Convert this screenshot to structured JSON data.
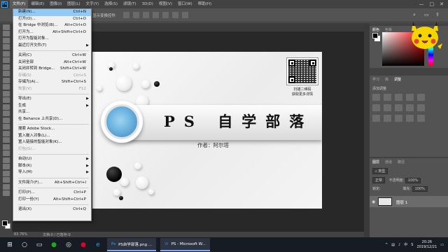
{
  "menubar": {
    "logo": "Ps",
    "items": [
      "文件(F)",
      "编辑(E)",
      "图像(I)",
      "图层(L)",
      "文字(Y)",
      "选择(S)",
      "滤镜(T)",
      "3D(D)",
      "视图(V)",
      "窗口(W)",
      "帮助(H)"
    ],
    "active_index": 0,
    "window_controls": [
      "—",
      "□",
      "✕"
    ]
  },
  "optionsbar": {
    "text": "显示变换控件"
  },
  "file_menu": {
    "groups": [
      [
        {
          "label": "新建(N)...",
          "shortcut": "Ctrl+N",
          "highlighted": true
        },
        {
          "label": "打开(O)...",
          "shortcut": "Ctrl+O"
        },
        {
          "label": "在 Bridge 中浏览(B)...",
          "shortcut": "Alt+Ctrl+O"
        },
        {
          "label": "打开为...",
          "shortcut": "Alt+Shift+Ctrl+O"
        },
        {
          "label": "打开为智能对象..."
        },
        {
          "label": "最近打开文件(T)",
          "submenu": true
        }
      ],
      [
        {
          "label": "关闭(C)",
          "shortcut": "Ctrl+W"
        },
        {
          "label": "关闭全部",
          "shortcut": "Alt+Ctrl+W"
        },
        {
          "label": "关闭并转到 Bridge...",
          "shortcut": "Shift+Ctrl+W"
        },
        {
          "label": "存储(S)",
          "shortcut": "Ctrl+S",
          "disabled": true
        },
        {
          "label": "存储为(A)...",
          "shortcut": "Shift+Ctrl+S"
        },
        {
          "label": "恢复(V)",
          "shortcut": "F12",
          "disabled": true
        }
      ],
      [
        {
          "label": "导出(E)",
          "submenu": true
        },
        {
          "label": "生成",
          "submenu": true
        },
        {
          "label": "共享..."
        },
        {
          "label": "在 Behance 上共享(D)..."
        }
      ],
      [
        {
          "label": "搜索 Adobe Stock..."
        },
        {
          "label": "置入嵌入对象(L)..."
        },
        {
          "label": "置入链接的智能对象(K)..."
        },
        {
          "label": "打包(G)...",
          "disabled": true
        }
      ],
      [
        {
          "label": "自动(U)",
          "submenu": true
        },
        {
          "label": "脚本(R)",
          "submenu": true
        },
        {
          "label": "导入(M)",
          "submenu": true
        }
      ],
      [
        {
          "label": "文件简介(F)...",
          "shortcut": "Alt+Shift+Ctrl+I"
        }
      ],
      [
        {
          "label": "打印(P)...",
          "shortcut": "Ctrl+P"
        },
        {
          "label": "打印一份(Y)",
          "shortcut": "Alt+Shift+Ctrl+P"
        }
      ],
      [
        {
          "label": "退出(X)",
          "shortcut": "Ctrl+Q"
        }
      ]
    ]
  },
  "document": {
    "title": "PS 自学部落",
    "author": "作者：阿尔塔",
    "qr_caption_1": "扫描二维码",
    "qr_caption_2": "获取更多详情"
  },
  "statusbar": {
    "zoom": "63.76%",
    "info": "文档:0 / 已暂存:0"
  },
  "panels": {
    "color_tabs": [
      "颜色",
      "色板"
    ],
    "adjust_tabs": [
      "学习",
      "库",
      "调整"
    ],
    "adjust_label": "添加调整",
    "layers_tabs": [
      "图层",
      "通道",
      "路径"
    ],
    "kind_label": "类型",
    "blend_mode": "正常",
    "opacity_label": "不透明度:",
    "opacity_value": "100%",
    "lock_label": "锁定:",
    "fill_label": "填充:",
    "fill_value": "100%",
    "layer_name": "图层 1"
  },
  "taskbar": {
    "tasks": [
      {
        "label": "PS自学部落.png ...",
        "icon": "photoshop-icon"
      },
      {
        "label": "PS - Microsoft W...",
        "icon": "word-icon"
      }
    ],
    "lang": "中",
    "time": "20:26",
    "date": "2019/12/21"
  },
  "colors": {
    "app_bg": "#535353",
    "menu_highlight": "#91c9f7",
    "taskbar": "#171c24"
  }
}
